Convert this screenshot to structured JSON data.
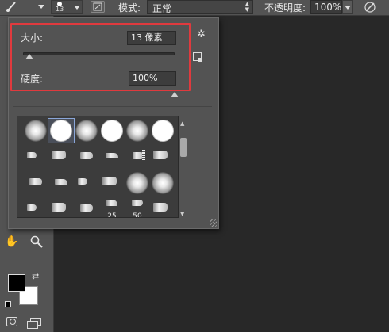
{
  "options_bar": {
    "brush_size_value": "13",
    "mode_label": "模式:",
    "mode_value": "正常",
    "opacity_label": "不透明度:",
    "opacity_value": "100%"
  },
  "brush_panel": {
    "size_label": "大小:",
    "size_value": "13 像素",
    "size_slider_fraction": 0.04,
    "hardness_label": "硬度:",
    "hardness_value": "100%",
    "hardness_slider_fraction": 1.0,
    "highlight_color": "#e03a3e",
    "presets": [
      {
        "kind": "soft",
        "label": ""
      },
      {
        "kind": "hard",
        "label": "",
        "selected": true
      },
      {
        "kind": "soft",
        "label": ""
      },
      {
        "kind": "hard",
        "label": ""
      },
      {
        "kind": "soft",
        "label": ""
      },
      {
        "kind": "hard",
        "label": ""
      },
      {
        "kind": "tip",
        "label": ""
      },
      {
        "kind": "tip",
        "label": ""
      },
      {
        "kind": "tip",
        "label": ""
      },
      {
        "kind": "tip",
        "label": ""
      },
      {
        "kind": "fan",
        "label": ""
      },
      {
        "kind": "tip",
        "label": ""
      },
      {
        "kind": "tip",
        "label": ""
      },
      {
        "kind": "tip",
        "label": ""
      },
      {
        "kind": "tip",
        "label": ""
      },
      {
        "kind": "tip",
        "label": ""
      },
      {
        "kind": "soft",
        "label": ""
      },
      {
        "kind": "soft",
        "label": ""
      },
      {
        "kind": "tip",
        "label": ""
      },
      {
        "kind": "tip",
        "label": ""
      },
      {
        "kind": "tip",
        "label": ""
      },
      {
        "kind": "tip",
        "label": "25"
      },
      {
        "kind": "tip",
        "label": "50"
      },
      {
        "kind": "tip",
        "label": ""
      }
    ]
  },
  "toolbox": {
    "foreground_color": "#000000",
    "background_color": "#ffffff"
  }
}
